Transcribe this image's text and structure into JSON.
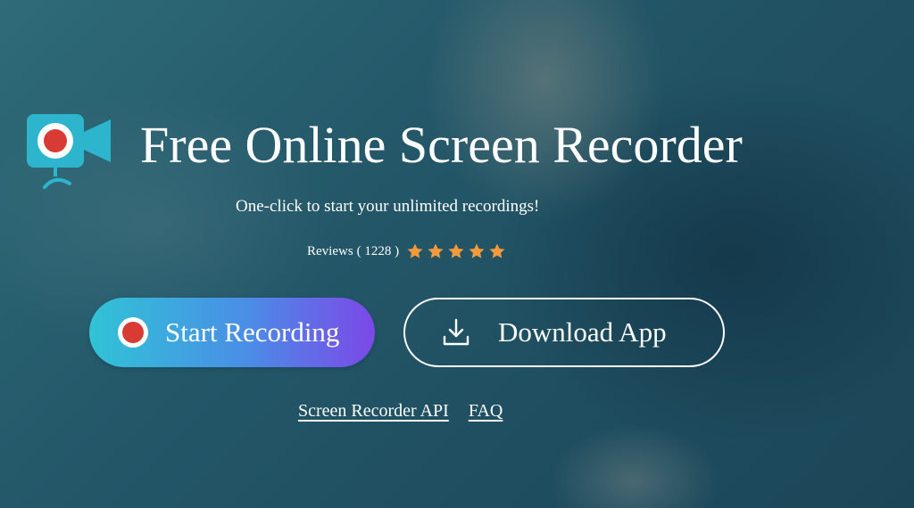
{
  "hero": {
    "title": "Free Online Screen Recorder",
    "subtitle": "One-click to start your unlimited recordings!",
    "reviews": {
      "label": "Reviews",
      "count": "( 1228 )",
      "rating": 5,
      "star_color": "#f59a3c"
    },
    "logo_icon": "video-camera-record-icon",
    "accent_colors": {
      "logo": "#2cb5cc",
      "record_red": "#d83a34",
      "button_gradient_start": "#30c3d6",
      "button_gradient_end": "#7c48e8"
    }
  },
  "buttons": {
    "start_recording": {
      "label": "Start Recording",
      "icon": "record-icon"
    },
    "download_app": {
      "label": "Download App",
      "icon": "download-icon"
    }
  },
  "links": {
    "api": "Screen Recorder API",
    "faq": "FAQ"
  }
}
